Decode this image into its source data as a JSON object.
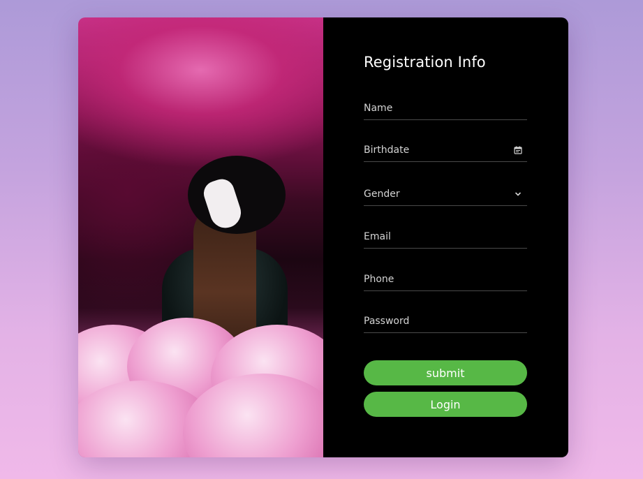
{
  "form": {
    "title": "Registration Info",
    "fields": [
      {
        "label": "Name",
        "icon": ""
      },
      {
        "label": "Birthdate",
        "icon": "calendar-icon"
      },
      {
        "label": "Gender",
        "icon": "chevron-down-icon"
      },
      {
        "label": "Email",
        "icon": ""
      },
      {
        "label": "Phone",
        "icon": ""
      },
      {
        "label": "Password",
        "icon": ""
      }
    ],
    "buttons": {
      "submit": "submit",
      "login": "Login"
    }
  },
  "colors": {
    "accent": "#57b846",
    "panel": "#000000",
    "background_top": "#ad9ad8",
    "background_bottom": "#f0b9e9"
  }
}
